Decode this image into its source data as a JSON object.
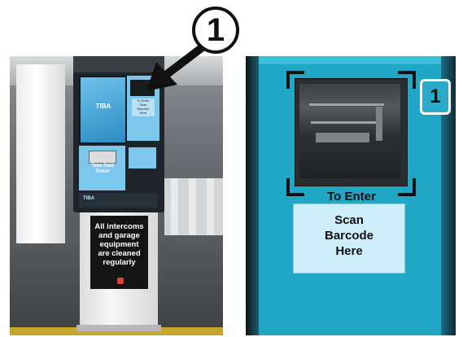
{
  "callout": {
    "number": "1"
  },
  "left_photo": {
    "screen_logo": "TIBA",
    "scan_sticker": [
      "To Enter",
      "Scan",
      "Barcode",
      "Here"
    ],
    "ticket_text": [
      "Take Paid",
      "Ticket"
    ],
    "brand_text": "TIBA",
    "sign_lines": [
      "All intercoms",
      "and garage",
      "equipment",
      "are cleaned",
      "regularly"
    ]
  },
  "right_photo": {
    "badge_number": "1",
    "enter_label": "To Enter",
    "card_lines": [
      "Scan",
      "Barcode",
      "Here"
    ]
  },
  "colors": {
    "kiosk_blue": "#7cc8ec",
    "panel_teal": "#21a7c6",
    "sign_black": "#141414",
    "floor_line_yellow": "#c9a62a"
  }
}
